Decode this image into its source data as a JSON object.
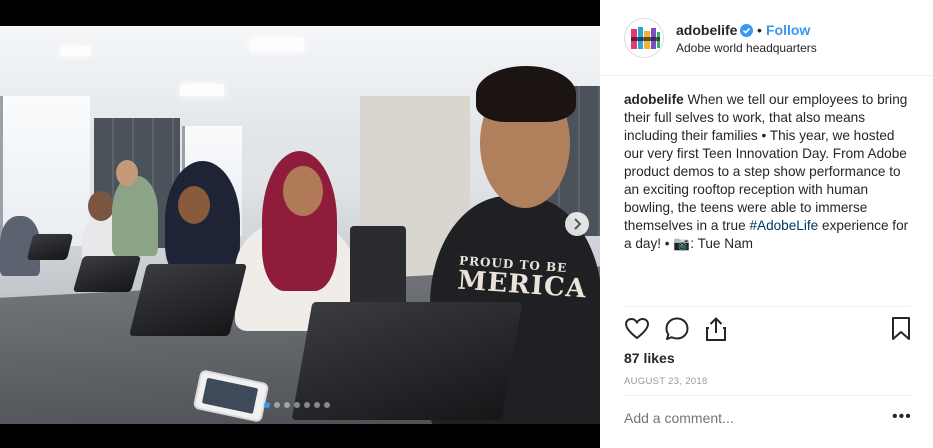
{
  "post": {
    "username": "adobelife",
    "verified": true,
    "follow_label": "Follow",
    "bullet": "•",
    "location": "Adobe world headquarters",
    "caption_username": "adobelife",
    "caption_text_1": " When we tell our employees to bring their full selves to work, that also means including their families • This year, we hosted our very first Teen Innovation Day. From Adobe product demos to a step show performance to an exciting rooftop reception with human bowling, the teens were able to immerse themselves in a true ",
    "caption_hashtag": "#AdobeLife",
    "caption_text_2": " experience for a day! • 📷: Tue Nam",
    "likes": "87 likes",
    "date": "AUGUST 23, 2018",
    "comment_placeholder": "Add a comment...",
    "more_label": "•••"
  },
  "photo": {
    "shirt_line1": "PROUD TO BE",
    "shirt_line2": "MERICA",
    "carousel_count": 7,
    "carousel_active": 1
  },
  "icons": {
    "like": "heart-icon",
    "comment": "comment-icon",
    "share": "share-icon",
    "save": "bookmark-icon",
    "next": "chevron-right-icon",
    "verified": "verified-badge-icon"
  },
  "colors": {
    "accent": "#3897f0",
    "hashtag": "#003569",
    "muted": "#999999"
  }
}
